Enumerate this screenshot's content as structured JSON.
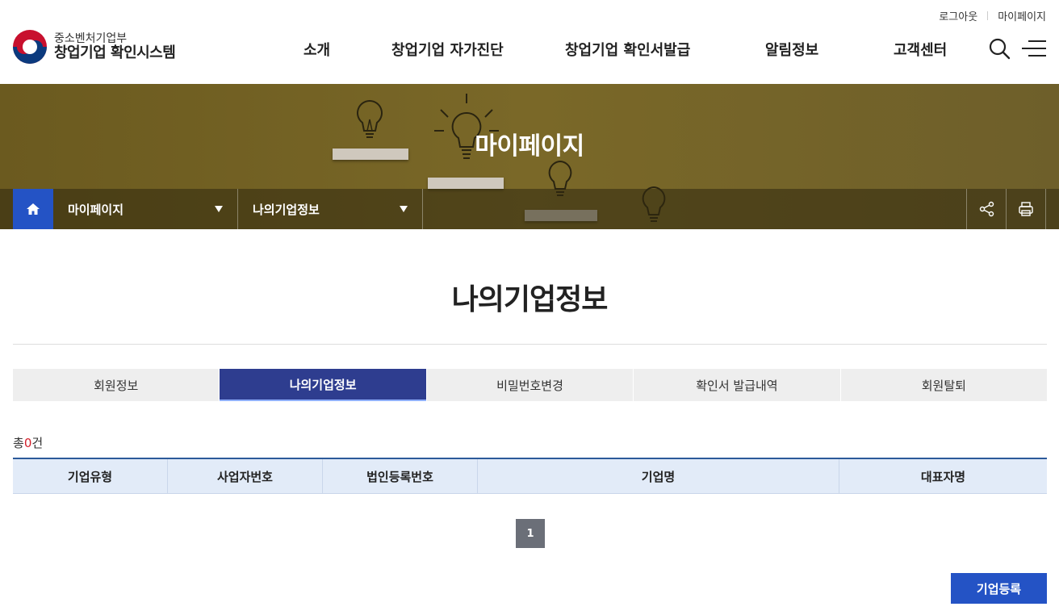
{
  "util": {
    "logout": "로그아웃",
    "mypage": "마이페이지"
  },
  "logo": {
    "ministry": "중소벤처기업부",
    "system": "창업기업 확인시스템"
  },
  "gnb": [
    "소개",
    "창업기업 자가진단",
    "창업기업 확인서발급",
    "알림정보",
    "고객센터"
  ],
  "banner": {
    "title": "마이페이지"
  },
  "breadcrumb": {
    "depth1": "마이페이지",
    "depth2": "나의기업정보"
  },
  "page": {
    "title": "나의기업정보"
  },
  "tabs": [
    {
      "label": "회원정보",
      "active": false
    },
    {
      "label": "나의기업정보",
      "active": true
    },
    {
      "label": "비밀번호변경",
      "active": false
    },
    {
      "label": "확인서 발급내역",
      "active": false
    },
    {
      "label": "회원탈퇴",
      "active": false
    }
  ],
  "total": {
    "prefix": "총",
    "count": "0",
    "suffix": "건"
  },
  "table": {
    "headers": [
      "기업유형",
      "사업자번호",
      "법인등록번호",
      "기업명",
      "대표자명"
    ],
    "rows": []
  },
  "pagination": {
    "current": "1"
  },
  "buttons": {
    "register": "기업등록"
  },
  "colors": {
    "accent": "#2453c5",
    "tab_active": "#2e3d8f",
    "count_red": "#d3202b",
    "table_head": "#e2ebf8"
  }
}
